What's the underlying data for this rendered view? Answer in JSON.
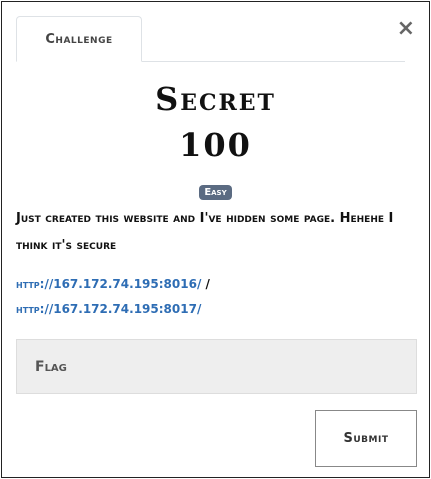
{
  "tab": {
    "label": "Challenge"
  },
  "close_icon": "×",
  "challenge": {
    "name": "Secret",
    "value": "100",
    "difficulty": "Easy",
    "description": "Just created this website and I've hidden some page. Hehehe I think it's secure",
    "link1": "http://167.172.74.195:8016/",
    "separator": "/",
    "link2": "http://167.172.74.195:8017/"
  },
  "form": {
    "flag_placeholder": "Flag",
    "submit_label": "Submit"
  }
}
